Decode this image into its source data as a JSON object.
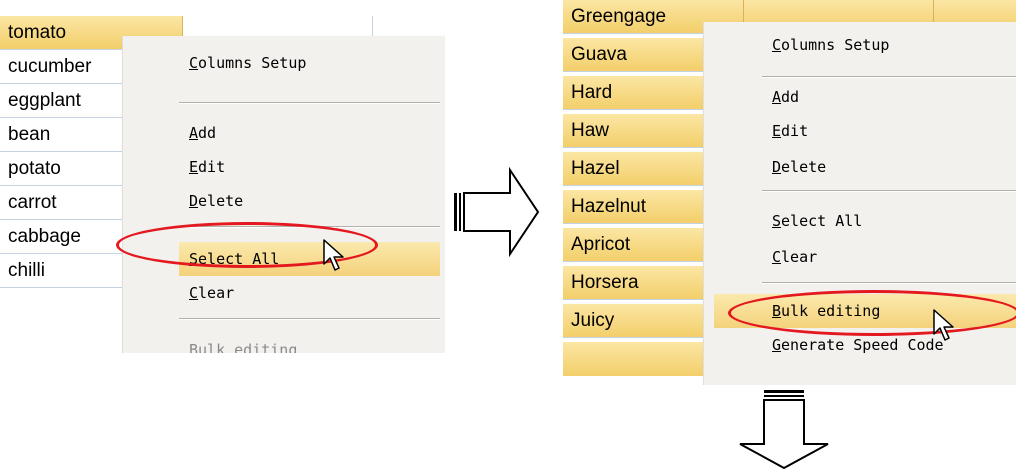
{
  "left_panel": {
    "rows": [
      "tomato",
      "cucumber",
      "eggplant",
      "bean",
      "potato",
      "carrot",
      "cabbage",
      "chilli"
    ],
    "menu": {
      "items": [
        {
          "label": "Columns Setup",
          "state": "normal"
        },
        {
          "label": "Add",
          "state": "normal"
        },
        {
          "label": "Edit",
          "state": "normal"
        },
        {
          "label": "Delete",
          "state": "normal"
        },
        {
          "label": "Select All",
          "state": "highlighted"
        },
        {
          "label": "Clear",
          "state": "normal"
        },
        {
          "label": "Bulk editing",
          "state": "disabled"
        }
      ]
    }
  },
  "right_panel": {
    "rows": [
      "Greengage",
      "Guava",
      "Hard",
      "Haw",
      "Hazel",
      "Hazelnut",
      "Apricot",
      "Horsera",
      "Juicy"
    ],
    "menu": {
      "items": [
        {
          "label": "Columns Setup",
          "state": "normal"
        },
        {
          "label": "Add",
          "state": "normal"
        },
        {
          "label": "Edit",
          "state": "normal"
        },
        {
          "label": "Delete",
          "state": "normal"
        },
        {
          "label": "Select All",
          "state": "normal"
        },
        {
          "label": "Clear",
          "state": "normal"
        },
        {
          "label": "Bulk editing",
          "state": "highlighted"
        },
        {
          "label": "Generate Speed Code",
          "state": "normal"
        }
      ]
    }
  },
  "colors": {
    "highlight_ellipse": "#e3191f",
    "selected_cell": "#f3cf6a",
    "menu_background": "#f3f1ee"
  }
}
